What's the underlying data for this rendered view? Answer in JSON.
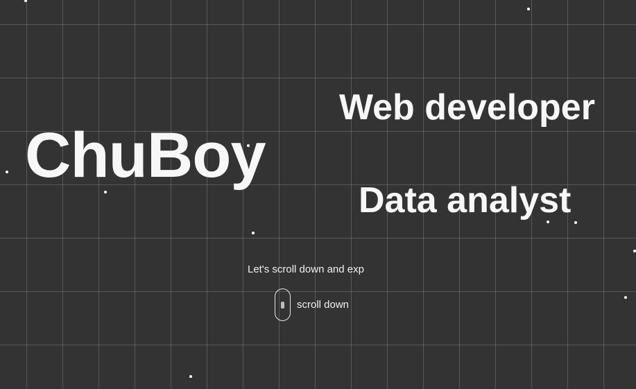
{
  "hero": {
    "name": "ChuBoy",
    "roles": [
      "Web developer",
      "Data analyst"
    ]
  },
  "intro": {
    "text": "Let's scroll down and exp"
  },
  "scroll_cue": {
    "label": "scroll down",
    "icon": "mouse-icon"
  },
  "colors": {
    "background": "#333333",
    "text": "#f7f7f7",
    "grid": "rgba(255,255,255,0.18)"
  }
}
